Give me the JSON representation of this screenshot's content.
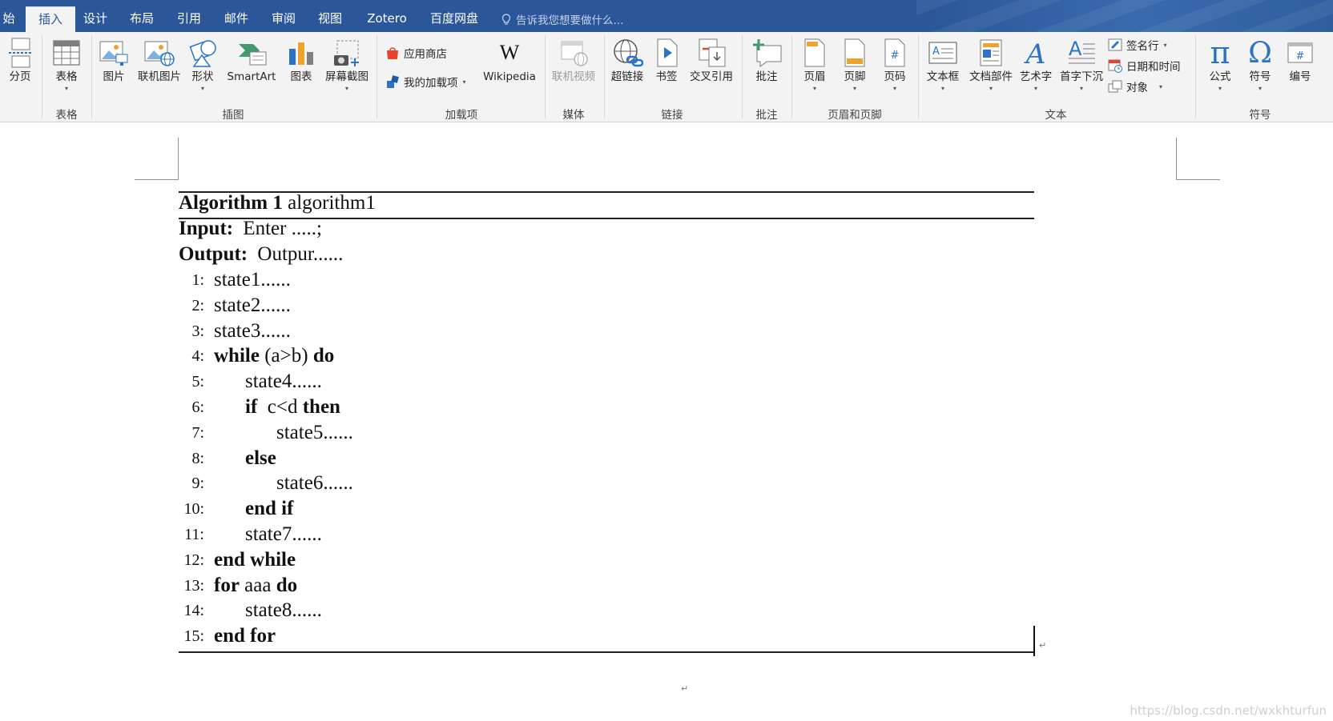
{
  "tabs": {
    "start_partial": "始",
    "insert": "插入",
    "design": "设计",
    "layout": "布局",
    "references": "引用",
    "mailings": "邮件",
    "review": "审阅",
    "view": "视图",
    "zotero": "Zotero",
    "baidu": "百度网盘",
    "tell_me": "告诉我您想要做什么..."
  },
  "ribbon": {
    "page_break": "分页",
    "table": "表格",
    "picture": "图片",
    "online_picture": "联机图片",
    "shapes": "形状",
    "smartart": "SmartArt",
    "chart": "图表",
    "screenshot": "屏幕截图",
    "store": "应用商店",
    "my_addins": "我的加载项",
    "wikipedia": "Wikipedia",
    "wikipedia_icon": "W",
    "online_video": "联机视频",
    "hyperlink": "超链接",
    "bookmark": "书签",
    "cross_ref": "交叉引用",
    "comment": "批注",
    "header": "页眉",
    "footer": "页脚",
    "page_number": "页码",
    "textbox": "文本框",
    "quick_parts": "文档部件",
    "wordart": "艺术字",
    "drop_cap": "首字下沉",
    "signature_line": "签名行",
    "date_time": "日期和时间",
    "object": "对象",
    "equation": "公式",
    "symbol": "符号",
    "numbering": "编号",
    "equation_icon": "π",
    "symbol_icon": "Ω",
    "groups": {
      "table": "表格",
      "illustrations": "插图",
      "addins": "加载项",
      "media": "媒体",
      "links": "链接",
      "comments": "批注",
      "header_footer": "页眉和页脚",
      "text": "文本",
      "symbols": "符号"
    }
  },
  "algorithm": {
    "title_bold": "Algorithm 1",
    "title_name": "algorithm1",
    "input_label": "Input:",
    "input_value": "Enter .....;",
    "output_label": "Output:",
    "output_value": "Outpur......",
    "lines": [
      {
        "num": "1:",
        "parts": [
          {
            "t": "state1......",
            "b": false
          }
        ],
        "indent": 0
      },
      {
        "num": "2:",
        "parts": [
          {
            "t": "state2......",
            "b": false
          }
        ],
        "indent": 0
      },
      {
        "num": "3:",
        "parts": [
          {
            "t": "state3......",
            "b": false
          }
        ],
        "indent": 0
      },
      {
        "num": "4:",
        "parts": [
          {
            "t": "while",
            "b": true
          },
          {
            "t": " (a>b) ",
            "b": false
          },
          {
            "t": "do",
            "b": true
          }
        ],
        "indent": 0
      },
      {
        "num": "5:",
        "parts": [
          {
            "t": "state4......",
            "b": false
          }
        ],
        "indent": 1
      },
      {
        "num": "6:",
        "parts": [
          {
            "t": "if",
            "b": true
          },
          {
            "t": "  c<d ",
            "b": false
          },
          {
            "t": "then",
            "b": true
          }
        ],
        "indent": 1
      },
      {
        "num": "7:",
        "parts": [
          {
            "t": "state5......",
            "b": false
          }
        ],
        "indent": 2
      },
      {
        "num": "8:",
        "parts": [
          {
            "t": "else",
            "b": true
          }
        ],
        "indent": 1
      },
      {
        "num": "9:",
        "parts": [
          {
            "t": "state6......",
            "b": false
          }
        ],
        "indent": 2
      },
      {
        "num": "10:",
        "parts": [
          {
            "t": "end if",
            "b": true
          }
        ],
        "indent": 1
      },
      {
        "num": "11:",
        "parts": [
          {
            "t": "state7......",
            "b": false
          }
        ],
        "indent": 1
      },
      {
        "num": "12:",
        "parts": [
          {
            "t": "end while",
            "b": true
          }
        ],
        "indent": 0
      },
      {
        "num": "13:",
        "parts": [
          {
            "t": "for",
            "b": true
          },
          {
            "t": " aaa ",
            "b": false
          },
          {
            "t": "do",
            "b": true
          }
        ],
        "indent": 0
      },
      {
        "num": "14:",
        "parts": [
          {
            "t": "state8......",
            "b": false
          }
        ],
        "indent": 1
      },
      {
        "num": "15:",
        "parts": [
          {
            "t": "end for",
            "b": true
          }
        ],
        "indent": 0
      }
    ]
  },
  "paragraph_mark": "↵",
  "watermark": "https://blog.csdn.net/wxkhturfun",
  "colors": {
    "tab_bar": "#2b579a",
    "ribbon_bg": "#f3f3f3",
    "accent_blue": "#2b579a"
  }
}
